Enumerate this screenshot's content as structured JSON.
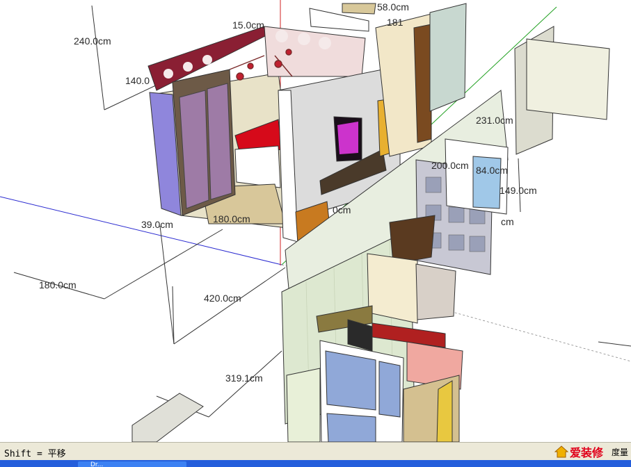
{
  "viewport": {
    "dimensions": [
      "240.0cm",
      "15.0cm",
      "58.0cm",
      "181",
      "140.0",
      "231.0cm",
      "200.0cm",
      "84.0cm",
      "149.0cm",
      "39.0cm",
      "180.0cm",
      "180.0cm",
      "420.0cm",
      "319.1cm",
      "0cm",
      "cm"
    ]
  },
  "statusbar": {
    "hint": "Shift = 平移",
    "measure_label": "度量",
    "watermark": "爱装修"
  },
  "taskbar": {
    "active_window": "Dr..."
  },
  "colors": {
    "status_bg": "#ece9d8",
    "taskbar": "#245edb",
    "watermark": "#e0001a"
  }
}
